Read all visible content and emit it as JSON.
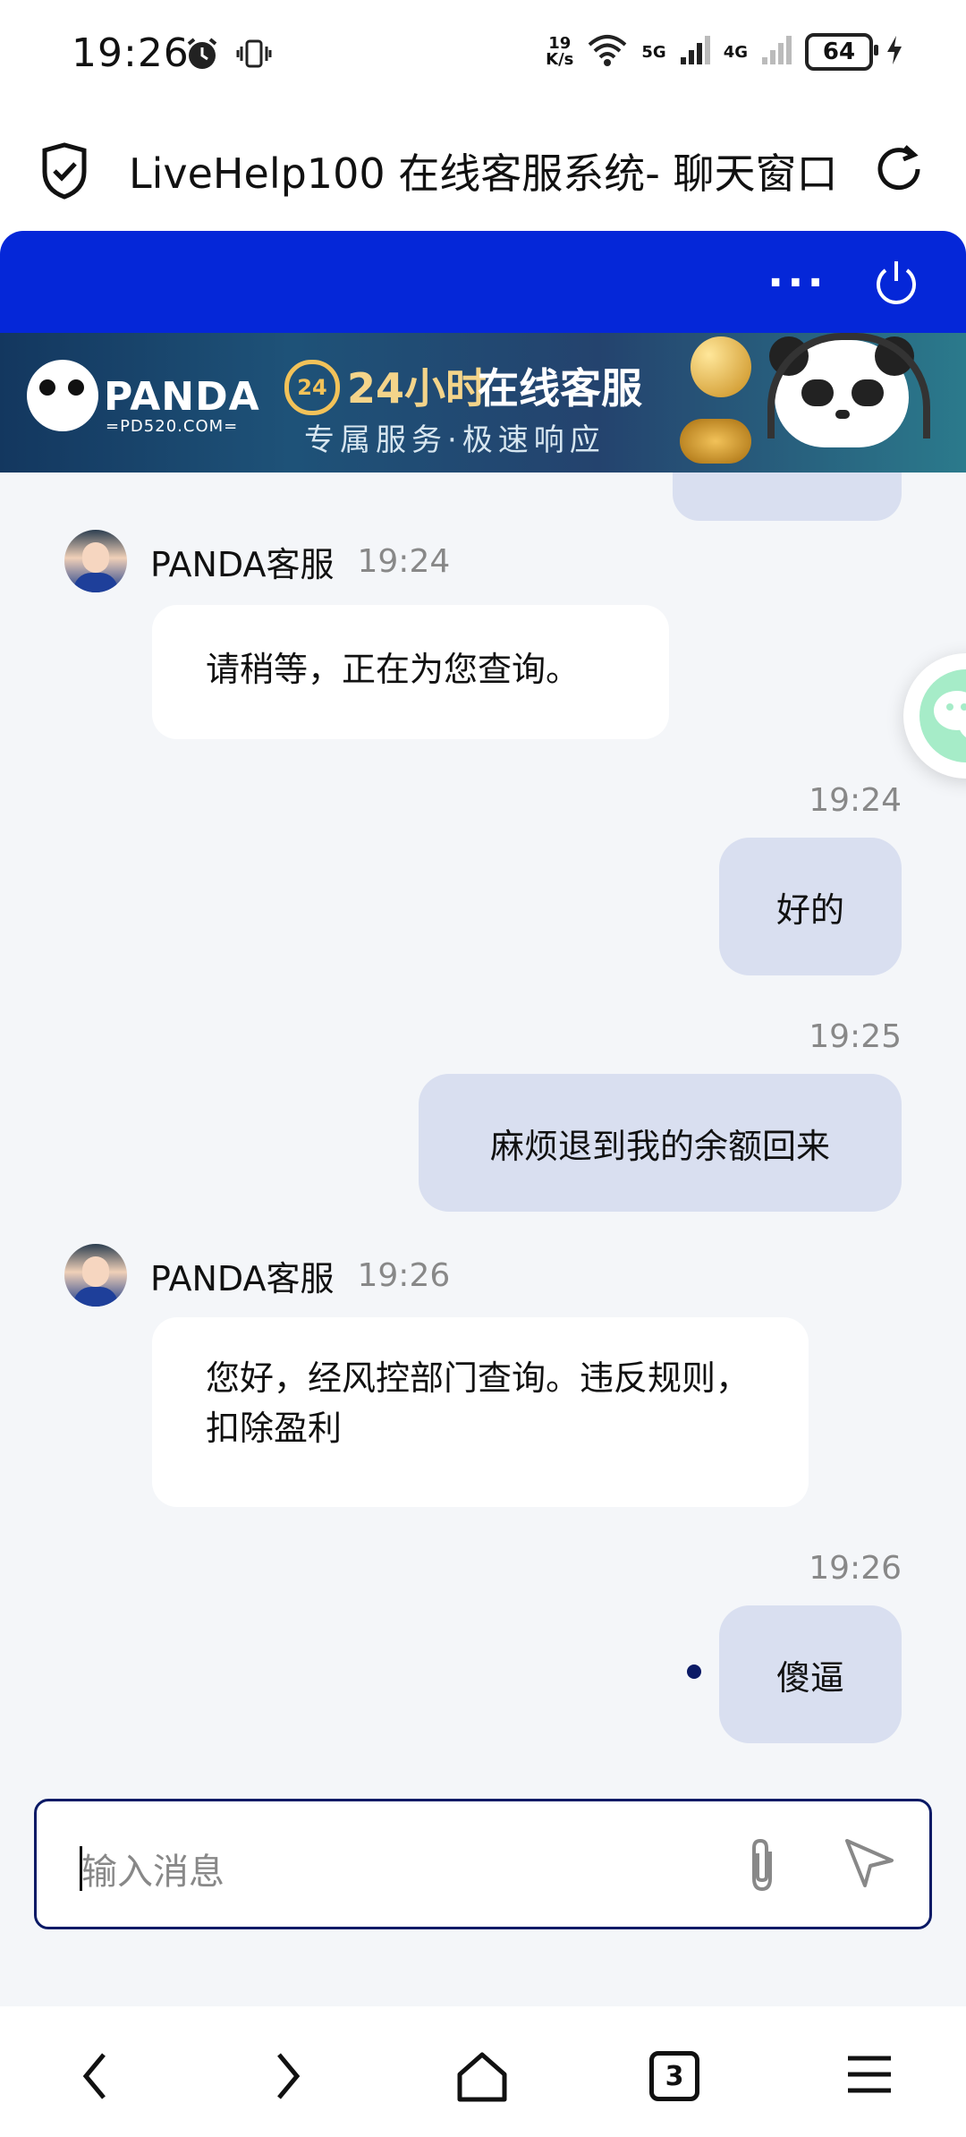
{
  "status_bar": {
    "time": "19:26",
    "net_speed_value": "19",
    "net_speed_unit": "K/s",
    "net1": "5G",
    "net2": "4G",
    "battery": "64"
  },
  "browser": {
    "page_title": "LiveHelp100 在线客服系统- 聊天窗口",
    "tab_count": "3"
  },
  "banner": {
    "brand": "PANDA",
    "brand_url": "=PD520.COM=",
    "clock_label": "24",
    "title_gold": "24小时",
    "title_white": "在线客服",
    "subtitle": "专属服务·极速响应"
  },
  "messages": [
    {
      "from": "agent",
      "name": "PANDA客服",
      "time": "19:24",
      "text": "请稍等，正在为您查询。"
    },
    {
      "from": "user",
      "time": "19:24",
      "text": "好的"
    },
    {
      "from": "user",
      "time": "19:25",
      "text": "麻烦退到我的余额回来"
    },
    {
      "from": "agent",
      "name": "PANDA客服",
      "time": "19:26",
      "text": "您好，经风控部门查询。违反规则，扣除盈利"
    },
    {
      "from": "user",
      "time": "19:26",
      "text": "傻逼"
    }
  ],
  "input": {
    "placeholder": "输入消息"
  },
  "colors": {
    "header_blue": "#0527d8",
    "user_bubble": "#d9dff0",
    "chat_bg": "#f4f6f9",
    "input_border": "#0b1a66"
  }
}
